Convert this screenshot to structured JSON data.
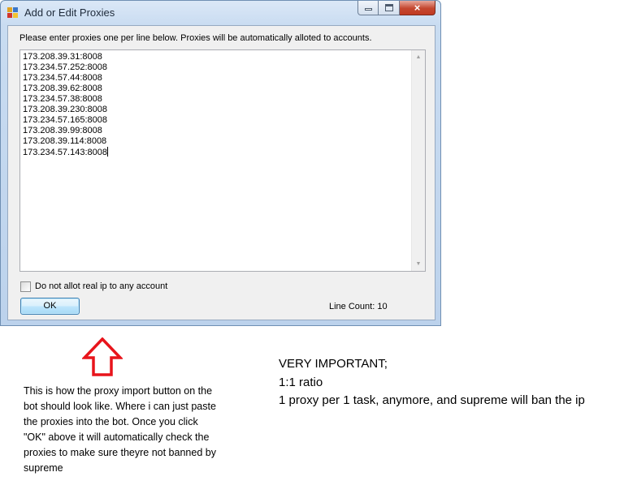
{
  "window": {
    "title": "Add or Edit Proxies",
    "close_glyph": "×"
  },
  "dialog": {
    "instructions": "Please enter proxies one per line below. Proxies will be automatically alloted to accounts.",
    "proxies": [
      "173.208.39.31:8008",
      "173.234.57.252:8008",
      "173.234.57.44:8008",
      "173.208.39.62:8008",
      "173.234.57.38:8008",
      "173.208.39.230:8008",
      "173.234.57.165:8008",
      "173.208.39.99:8008",
      "173.208.39.114:8008",
      "173.234.57.143:8008"
    ],
    "checkbox_label": "Do not allot real ip to any account",
    "checkbox_checked": false,
    "ok_label": "OK",
    "line_count_label": "Line Count:",
    "line_count_value": "10"
  },
  "annotations": {
    "left_note": "This is how the proxy import button on the bot should look like. Where i can just paste the proxies into the bot. Once you click \"OK\" above it will automatically check the proxies to make sure theyre not banned by supreme",
    "right_note": [
      "VERY IMPORTANT;",
      "1:1 ratio",
      "1 proxy per 1 task, anymore, and supreme will ban the ip"
    ],
    "arrow_color": "#e8141b"
  }
}
